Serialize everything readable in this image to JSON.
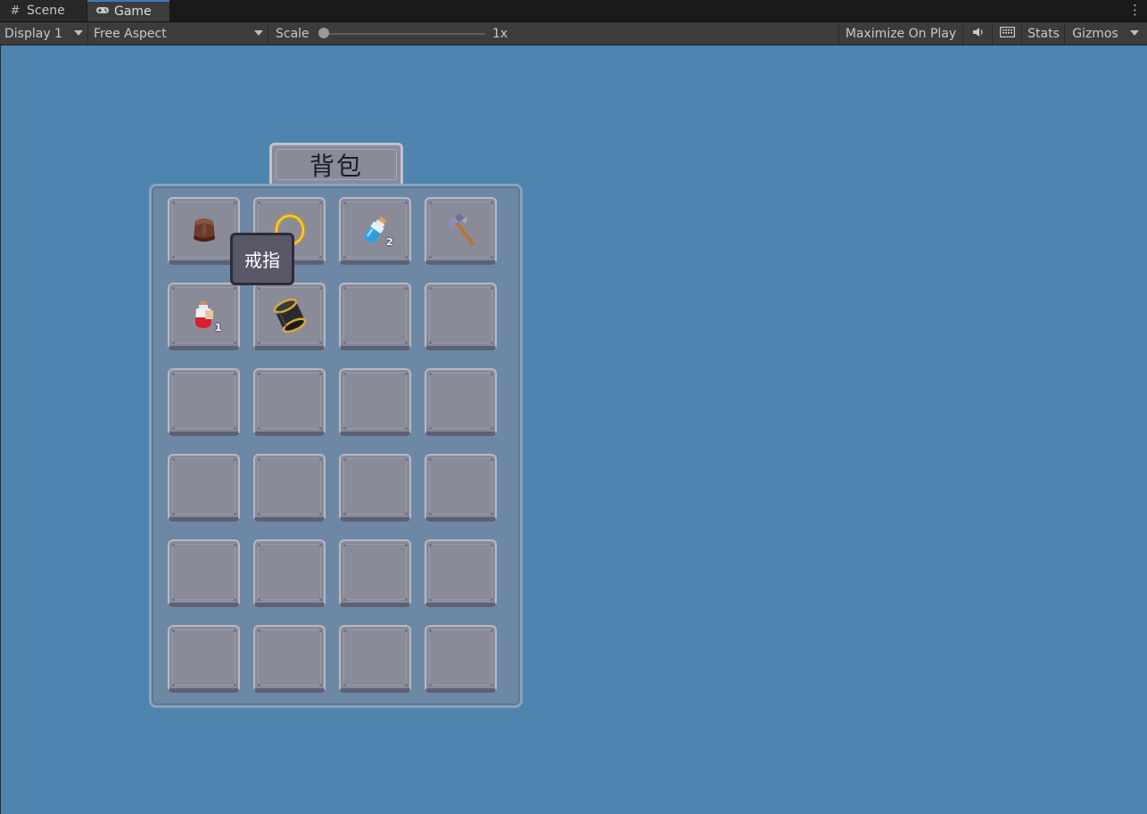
{
  "tabs": [
    {
      "label": "Scene",
      "icon": "grid-icon"
    },
    {
      "label": "Game",
      "icon": "gamepad-icon"
    }
  ],
  "toolbar": {
    "display": "Display 1",
    "aspect": "Free Aspect",
    "scale_label": "Scale",
    "scale_value": "1x",
    "scale_slider_fraction": 0,
    "maximize": "Maximize On Play",
    "mute_icon": "speaker-icon",
    "keyboard_icon": "keyboard-icon",
    "stats": "Stats",
    "gizmos": "Gizmos"
  },
  "game": {
    "background": "#4e84ad",
    "inventory_title": "背包",
    "tooltip": "戒指",
    "slots": [
      {
        "item": "leather-bracer-icon",
        "count": ""
      },
      {
        "item": "gold-ring-icon",
        "count": ""
      },
      {
        "item": "blue-potion-icon",
        "count": "2"
      },
      {
        "item": "battle-axe-icon",
        "count": ""
      },
      {
        "item": "red-potion-icon",
        "count": "1"
      },
      {
        "item": "dark-band-icon",
        "count": ""
      }
    ],
    "total_slots": 24
  }
}
